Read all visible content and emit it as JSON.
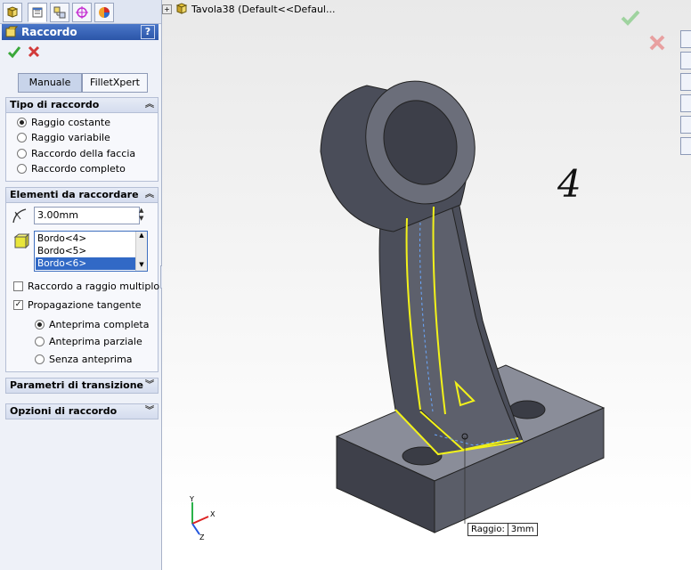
{
  "tabs": [
    {
      "icon": "feature-manager-icon"
    },
    {
      "icon": "property-manager-icon"
    },
    {
      "icon": "configuration-manager-icon"
    },
    {
      "icon": "dimxpert-icon"
    },
    {
      "icon": "display-manager-icon"
    }
  ],
  "property_manager": {
    "title": "Raccordo",
    "help": "?",
    "mode_tabs": [
      "Manuale",
      "FilletXpert"
    ],
    "active_mode": "Manuale"
  },
  "tipo": {
    "title": "Tipo di raccordo",
    "options": [
      "Raggio costante",
      "Raggio variabile",
      "Raccordo della faccia",
      "Raccordo completo"
    ],
    "selected": "Raggio costante"
  },
  "elementi": {
    "title": "Elementi da raccordare",
    "radius_value": "3.00mm",
    "edges": [
      "Bordo<4>",
      "Bordo<5>",
      "Bordo<6>"
    ],
    "selected_edge": "Bordo<6>",
    "multi_radius_label": "Raccordo a raggio multiplo",
    "multi_radius_checked": false,
    "tangent_label": "Propagazione tangente",
    "tangent_checked": true,
    "preview_options": [
      "Anteprima completa",
      "Anteprima parziale",
      "Senza anteprima"
    ],
    "preview_selected": "Anteprima completa"
  },
  "collapsed_groups": [
    "Parametri di transizione",
    "Opzioni di raccordo"
  ],
  "viewport": {
    "tree_label": "Tavola38  (Default<<Defaul...",
    "annotation": "4",
    "callout_label": "Raggio:",
    "callout_value": "3mm",
    "triad_labels": [
      "Y",
      "X",
      "Z"
    ]
  },
  "colors": {
    "header_blue": "#2b55a8",
    "model_gray": "#5e6170",
    "highlight_yellow": "#f2f21a",
    "ok_green": "#3aa83a",
    "cancel_red": "#d23a3a"
  }
}
